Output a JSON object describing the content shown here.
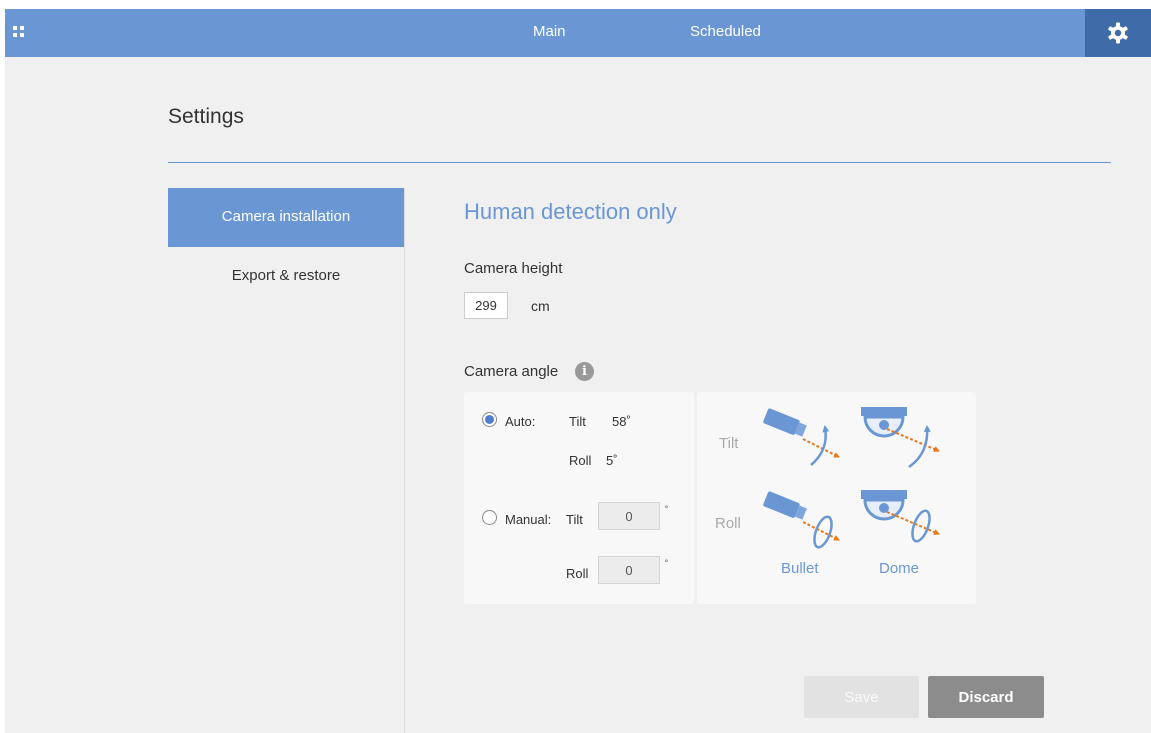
{
  "topbar": {
    "tabs": [
      {
        "label": "Main"
      },
      {
        "label": "Scheduled"
      }
    ],
    "menu_icon": "grid-icon",
    "settings_icon": "gear-icon",
    "color": "#6a97d4",
    "active_color": "#3f6ca8"
  },
  "page": {
    "title": "Settings"
  },
  "sidebar": {
    "items": [
      {
        "label": "Camera installation",
        "active": true
      },
      {
        "label": "Export & restore",
        "active": false
      }
    ]
  },
  "main": {
    "section_title": "Human detection only",
    "camera_height": {
      "label": "Camera height",
      "value": "299",
      "unit": "cm"
    },
    "camera_angle": {
      "label": "Camera angle",
      "info_icon": "info-icon",
      "auto": {
        "label": "Auto:",
        "selected": true,
        "tilt_label": "Tilt",
        "tilt_value": "58˚",
        "roll_label": "Roll",
        "roll_value": "5˚"
      },
      "manual": {
        "label": "Manual:",
        "selected": false,
        "tilt_label": "Tilt",
        "tilt_value": "0",
        "roll_label": "Roll",
        "roll_value": "0",
        "degree_symbol": "˚"
      }
    },
    "legend": {
      "tilt_label": "Tilt",
      "roll_label": "Roll",
      "captions": [
        "Bullet",
        "Dome"
      ],
      "icons": [
        "bullet-tilt-icon",
        "dome-tilt-icon",
        "bullet-roll-icon",
        "dome-roll-icon"
      ]
    }
  },
  "actions": {
    "save_label": "Save",
    "discard_label": "Discard"
  }
}
